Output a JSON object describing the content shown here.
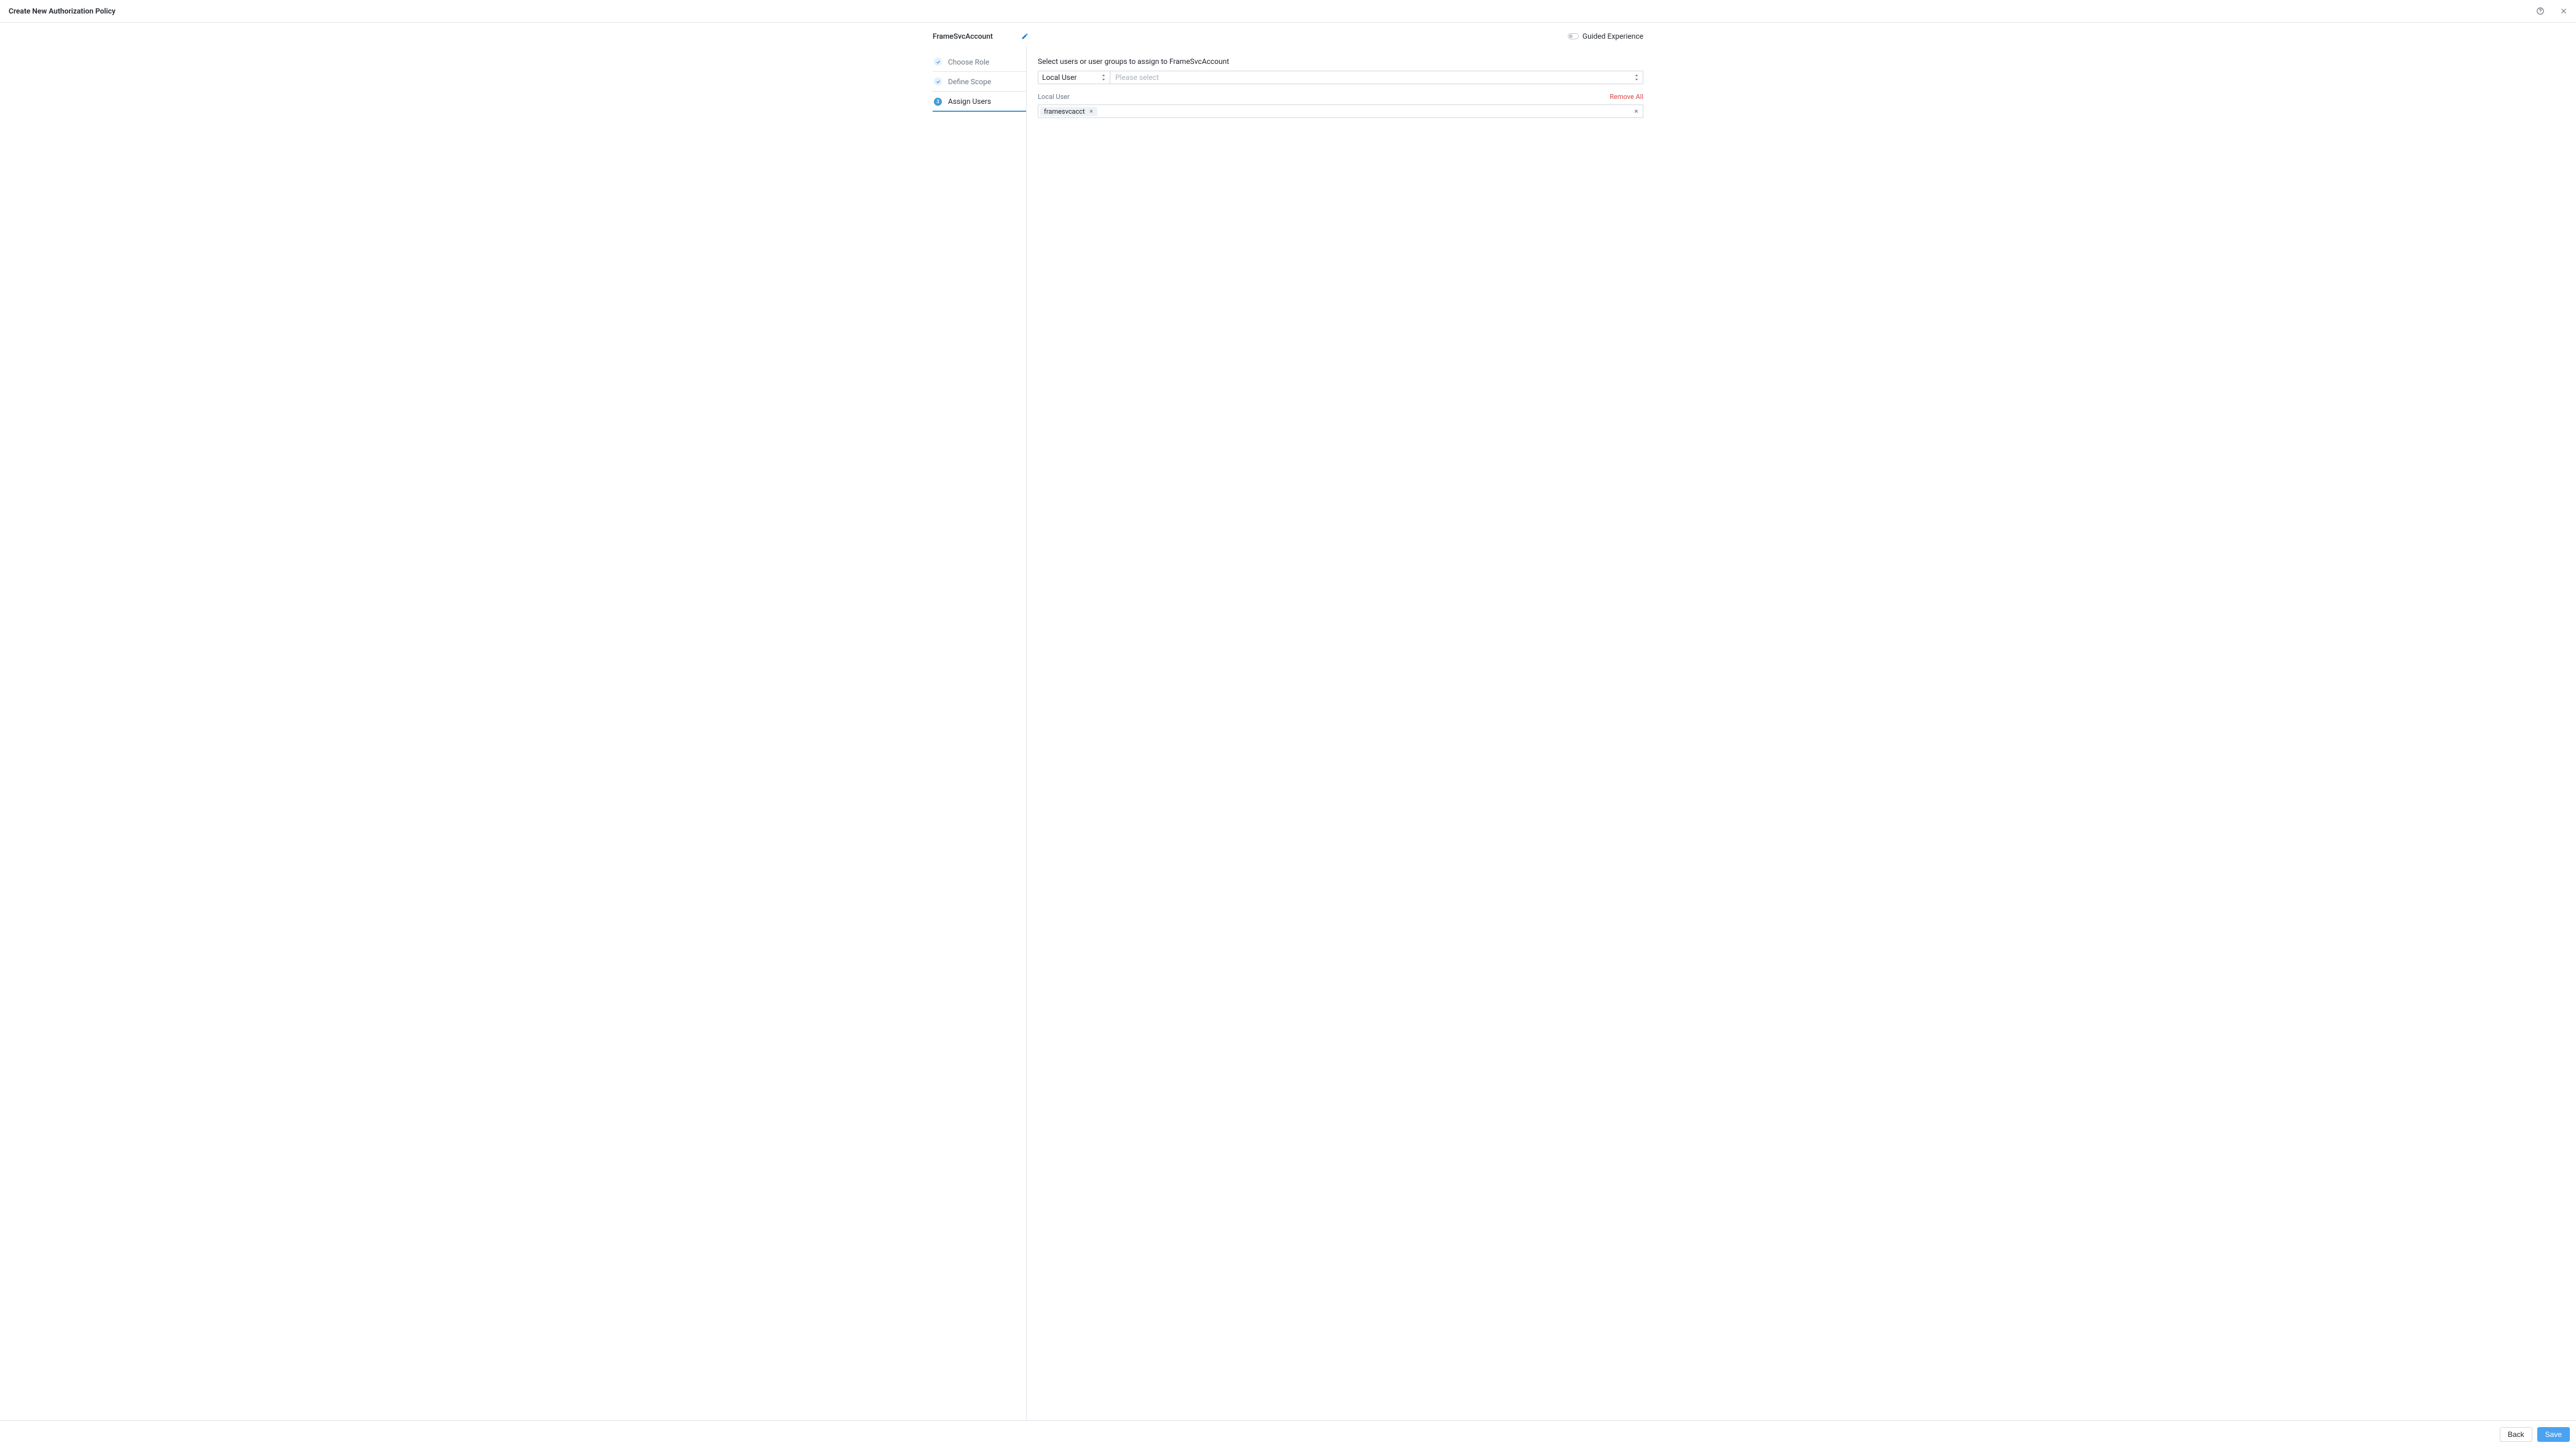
{
  "header": {
    "title": "Create New Authorization Policy"
  },
  "guided": {
    "label": "Guided Experience",
    "enabled": false
  },
  "policy": {
    "name": "FrameSvcAccount"
  },
  "steps": [
    {
      "label": "Choose Role",
      "state": "done"
    },
    {
      "label": "Define Scope",
      "state": "done"
    },
    {
      "label": "Assign Users",
      "state": "current"
    }
  ],
  "assign": {
    "instruction": "Select users or user groups to assign to FrameSvcAccount",
    "type_select_value": "Local User",
    "combo_placeholder": "Please select",
    "section_label": "Local User",
    "remove_all_label": "Remove All",
    "selected": [
      {
        "label": "framesvcacct"
      }
    ]
  },
  "footer": {
    "back_label": "Back",
    "save_label": "Save"
  }
}
